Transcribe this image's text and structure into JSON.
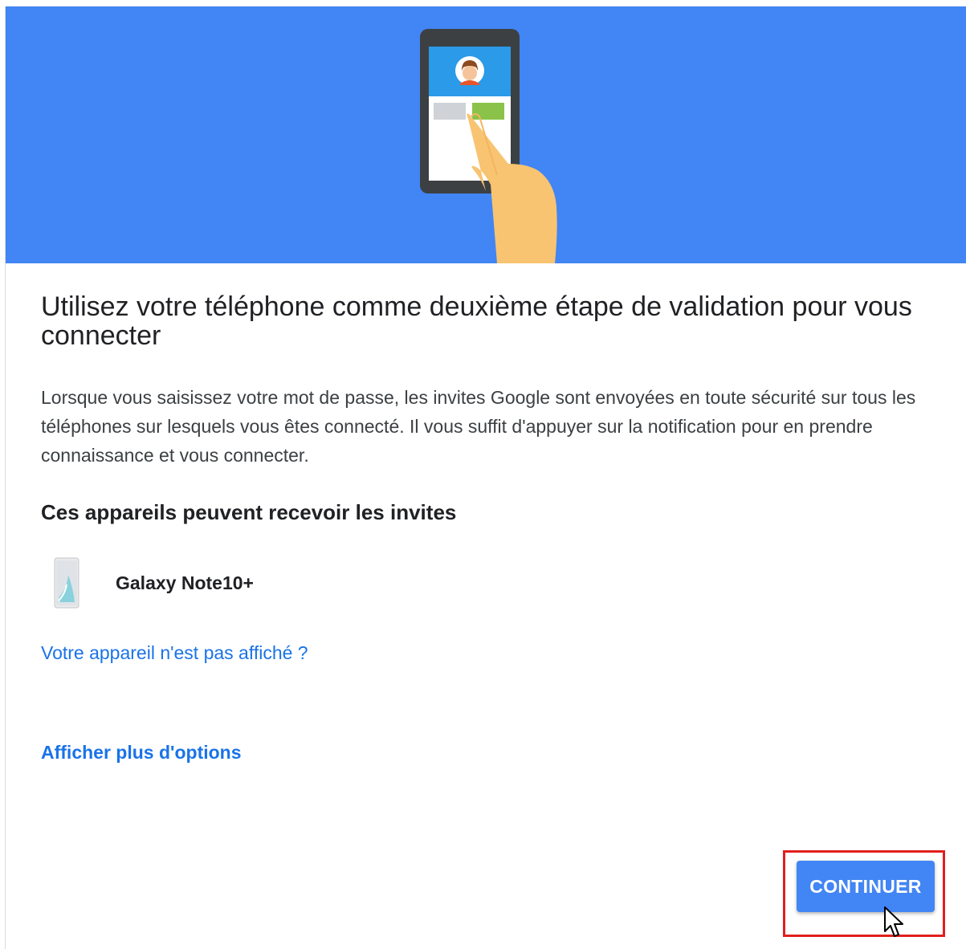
{
  "banner": {
    "background": "#4285f4",
    "illustration": "phone-tap-illustration"
  },
  "page": {
    "title": "Utilisez votre téléphone comme deuxième étape de validation pour vous connecter",
    "description": "Lorsque vous saisissez votre mot de passe, les invites Google sont envoyées en toute sécurité sur tous les téléphones sur lesquels vous êtes connecté. Il vous suffit d'appuyer sur la notification pour en prendre connaissance et vous connecter.",
    "devices_heading": "Ces appareils peuvent recevoir les invites"
  },
  "devices": [
    {
      "name": "Galaxy Note10+",
      "icon": "smartphone-icon"
    }
  ],
  "links": {
    "device_missing": "Votre appareil n'est pas affiché ?",
    "more_options": "Afficher plus d'options"
  },
  "actions": {
    "continue_label": "CONTINUER",
    "continue_color": "#4285f4",
    "highlight_color": "#e0201c"
  },
  "colors": {
    "link": "#1a73e8",
    "text": "#202124"
  }
}
